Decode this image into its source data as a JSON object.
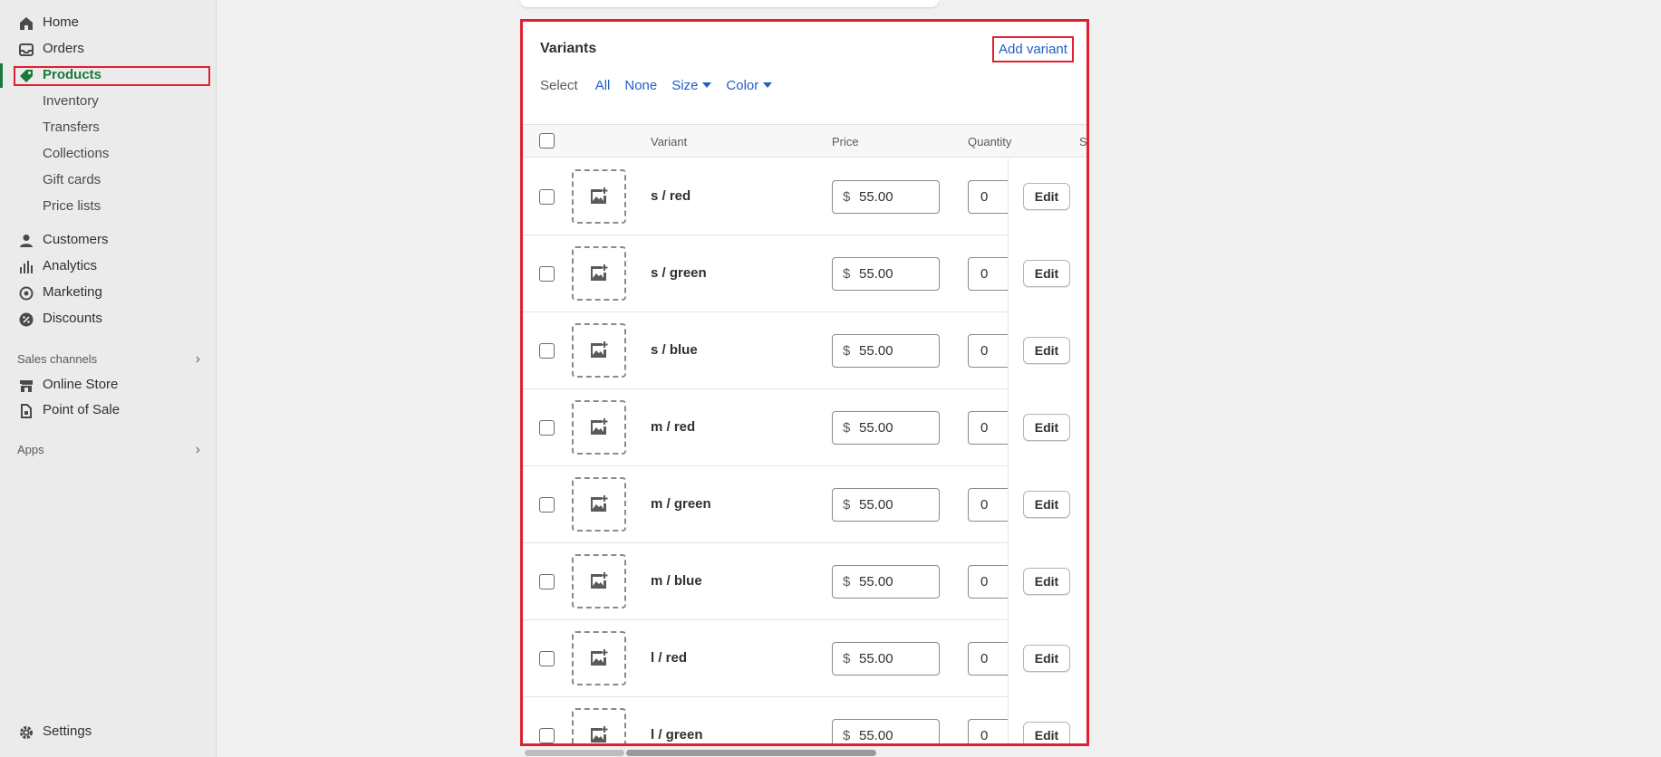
{
  "sidebar": {
    "items": [
      {
        "label": "Home",
        "icon": "home-icon"
      },
      {
        "label": "Orders",
        "icon": "inbox-icon"
      },
      {
        "label": "Products",
        "icon": "tag-icon"
      },
      {
        "label": "Inventory"
      },
      {
        "label": "Transfers"
      },
      {
        "label": "Collections"
      },
      {
        "label": "Gift cards"
      },
      {
        "label": "Price lists"
      },
      {
        "label": "Customers",
        "icon": "person-icon"
      },
      {
        "label": "Analytics",
        "icon": "bar-chart-icon"
      },
      {
        "label": "Marketing",
        "icon": "target-icon"
      },
      {
        "label": "Discounts",
        "icon": "discount-icon"
      },
      {
        "label": "Online Store",
        "icon": "store-icon"
      },
      {
        "label": "Point of Sale",
        "icon": "pos-icon"
      }
    ],
    "sales_channels": "Sales channels",
    "apps": "Apps",
    "settings": "Settings",
    "active_color": "#1a7a3a"
  },
  "variants": {
    "title": "Variants",
    "add_variant": "Add variant",
    "select_label": "Select",
    "select_all": "All",
    "select_none": "None",
    "filter_size": "Size",
    "filter_color": "Color",
    "columns": {
      "variant": "Variant",
      "price": "Price",
      "quantity": "Quantity",
      "overflow": "S"
    },
    "currency": "$",
    "edit_label": "Edit",
    "rows": [
      {
        "name": "s / red",
        "price": "55.00",
        "qty": "0"
      },
      {
        "name": "s / green",
        "price": "55.00",
        "qty": "0"
      },
      {
        "name": "s / blue",
        "price": "55.00",
        "qty": "0"
      },
      {
        "name": "m / red",
        "price": "55.00",
        "qty": "0"
      },
      {
        "name": "m / green",
        "price": "55.00",
        "qty": "0"
      },
      {
        "name": "m / blue",
        "price": "55.00",
        "qty": "0"
      },
      {
        "name": "l / red",
        "price": "55.00",
        "qty": "0"
      },
      {
        "name": "l / green",
        "price": "55.00",
        "qty": "0"
      }
    ]
  },
  "colors": {
    "link": "#1f5fc7",
    "highlight": "#e02030"
  }
}
